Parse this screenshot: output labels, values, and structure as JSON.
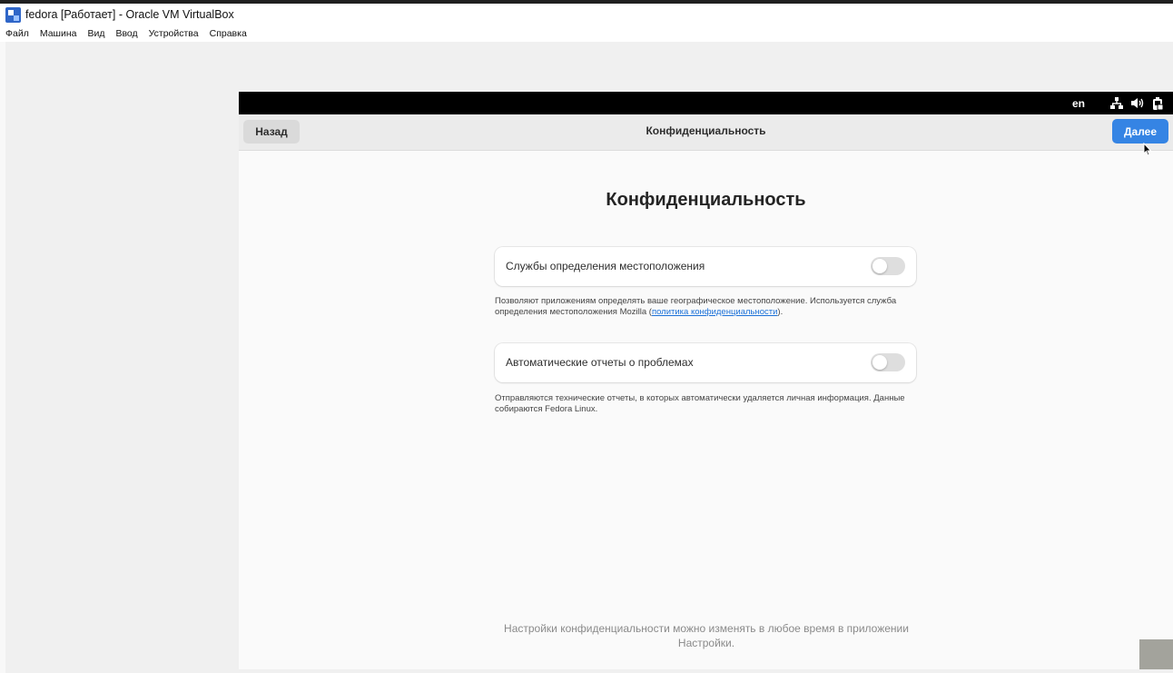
{
  "host": {
    "title": "fedora [Работает] - Oracle VM VirtualBox",
    "menu": [
      "Файл",
      "Машина",
      "Вид",
      "Ввод",
      "Устройства",
      "Справка"
    ]
  },
  "vm": {
    "top_bar": {
      "keyboard_layout": "en",
      "icons": [
        "network-icon",
        "volume-icon",
        "battery-icon"
      ]
    },
    "header": {
      "back_label": "Назад",
      "title": "Конфиденциальность",
      "next_label": "Далее"
    },
    "page": {
      "heading": "Конфиденциальность",
      "location": {
        "label": "Службы определения местоположения",
        "enabled": false,
        "desc_before": "Позволяют приложениям определять ваше географическое местоположение. Используется служба определения местоположения Mozilla (",
        "link_text": "политика конфиденциальности",
        "desc_after": ")."
      },
      "reports": {
        "label": "Автоматические отчеты о проблемах",
        "enabled": false,
        "desc": "Отправляются технические отчеты, в которых автоматически удаляется личная информация. Данные собираются Fedora Linux."
      },
      "footer": "Настройки конфиденциальности можно изменять в любое время в приложении Настройки."
    },
    "colors": {
      "accent": "#3584e4",
      "top_bar": "#000000",
      "link": "#1c71d8"
    }
  }
}
